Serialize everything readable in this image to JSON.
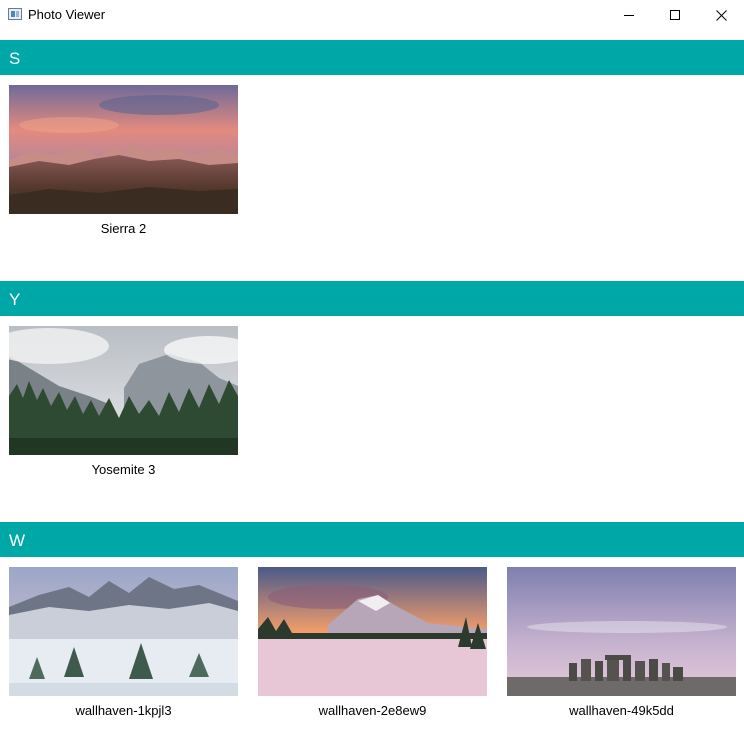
{
  "window": {
    "title": "Photo Viewer",
    "icon": "app-window-icon",
    "controls": [
      "minimize-icon",
      "maximize-icon",
      "close-icon"
    ]
  },
  "colors": {
    "section_header_bg": "#00a7a7",
    "section_header_text": "#ffffff"
  },
  "groups": [
    {
      "letter": "S",
      "photos": [
        {
          "name": "Sierra 2"
        }
      ]
    },
    {
      "letter": "Y",
      "photos": [
        {
          "name": "Yosemite 3"
        }
      ]
    },
    {
      "letter": "W",
      "photos": [
        {
          "name": "wallhaven-1kpjl3"
        },
        {
          "name": "wallhaven-2e8ew9"
        },
        {
          "name": "wallhaven-49k5dd"
        }
      ]
    }
  ]
}
